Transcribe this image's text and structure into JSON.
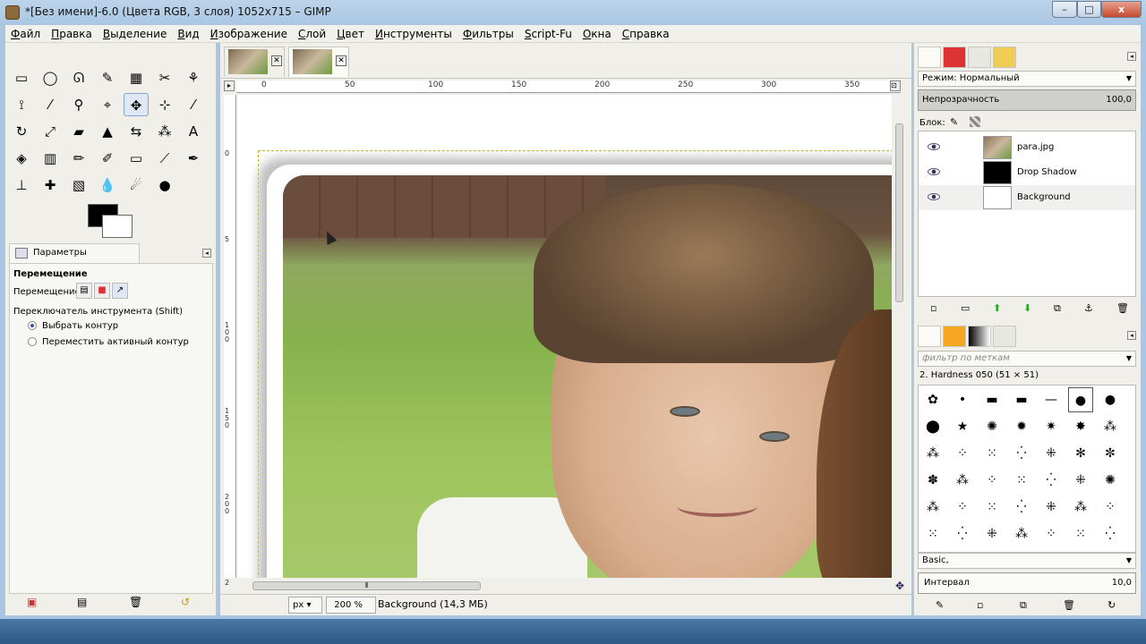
{
  "window": {
    "title": "*[Без имени]-6.0 (Цвета RGB, 3 слоя) 1052x715 – GIMP",
    "min_label": "–",
    "max_label": "□",
    "close_label": "x"
  },
  "menu": [
    "Файл",
    "Правка",
    "Выделение",
    "Вид",
    "Изображение",
    "Слой",
    "Цвет",
    "Инструменты",
    "Фильтры",
    "Script-Fu",
    "Окна",
    "Справка"
  ],
  "tools": [
    [
      "rect-select",
      "▭"
    ],
    [
      "ellipse-select",
      "◯"
    ],
    [
      "free-select",
      "ᘏ"
    ],
    [
      "fuzzy-select",
      "✎"
    ],
    [
      "color-select",
      "▦"
    ],
    [
      "scissors",
      "✂"
    ],
    [
      "foreground-select",
      "⚘"
    ],
    [
      "paths",
      "⟟"
    ],
    [
      "color-picker",
      "⁄"
    ],
    [
      "zoom",
      "⚲"
    ],
    [
      "measure",
      "⌖"
    ],
    [
      "move",
      "✥"
    ],
    [
      "align",
      "⊹"
    ],
    [
      "crop",
      "⁄"
    ],
    [
      "rotate",
      "↻"
    ],
    [
      "scale",
      "⤢"
    ],
    [
      "shear",
      "▰"
    ],
    [
      "perspective",
      "▲"
    ],
    [
      "flip",
      "⇆"
    ],
    [
      "cage",
      "⁂"
    ],
    [
      "text",
      "A"
    ],
    [
      "bucket-fill",
      "◈"
    ],
    [
      "blend",
      "▥"
    ],
    [
      "pencil",
      "✏"
    ],
    [
      "paintbrush",
      "✐"
    ],
    [
      "eraser",
      "▭"
    ],
    [
      "airbrush",
      "⟋"
    ],
    [
      "ink",
      "✒"
    ],
    [
      "clone",
      "⊥"
    ],
    [
      "heal",
      "✚"
    ],
    [
      "perspective-clone",
      "▧"
    ],
    [
      "blur",
      "💧"
    ],
    [
      "smudge",
      "☄"
    ],
    [
      "dodge-burn",
      "●"
    ]
  ],
  "tool_options": {
    "tab": "Параметры инструментов",
    "section": "Перемещение",
    "move_label": "Перемещение:",
    "toggle_label": "Переключатель инструмента  (Shift)",
    "option1": "Выбрать контур",
    "option2": "Переместить активный контур"
  },
  "ruler_h": [
    "0",
    "50",
    "100",
    "150",
    "200",
    "250",
    "300",
    "350"
  ],
  "ruler_v": [
    "0",
    "5",
    "100",
    "150",
    "200",
    "2"
  ],
  "status": {
    "unit": "px",
    "zoom": "200 %",
    "info": "Background (14,3 МБ)"
  },
  "layers": {
    "mode_label": "Режим:",
    "mode_value": "Нормальный",
    "opacity_label": "Непрозрачность",
    "opacity_value": "100,0",
    "lock_label": "Блок:",
    "items": [
      {
        "name": "para.jpg",
        "thumb": "#8b7355"
      },
      {
        "name": "Drop Shadow",
        "thumb": "#000000"
      },
      {
        "name": "Background",
        "thumb": "#ffffff"
      }
    ]
  },
  "brushes": {
    "filter_placeholder": "фильтр по меткам",
    "current": "2. Hardness 050 (51 × 51)",
    "set": "Basic,",
    "interval_label": "Интервал",
    "interval_value": "10,0"
  }
}
